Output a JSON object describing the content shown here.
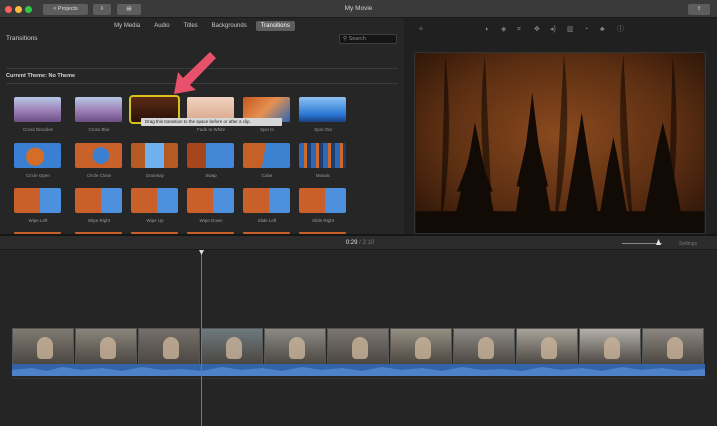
{
  "window": {
    "title": "My Movie",
    "projects_button": "< Projects",
    "colors": {
      "accent_selected": "#d6c21a",
      "arrow": "#e8516b",
      "audio": "#3364a8"
    }
  },
  "browser": {
    "tabs": [
      {
        "label": "My Media",
        "active": false
      },
      {
        "label": "Audio",
        "active": false
      },
      {
        "label": "Titles",
        "active": false
      },
      {
        "label": "Backgrounds",
        "active": false
      },
      {
        "label": "Transitions",
        "active": true
      }
    ],
    "section_title": "Transitions",
    "search_placeholder": "Search",
    "current_theme": "Current Theme: No Theme",
    "tooltip": "Drag this transition to the space before or after a clip.",
    "transitions": [
      {
        "label": "Cross Dissolve",
        "style": "mist"
      },
      {
        "label": "Cross Blur",
        "style": "mist"
      },
      {
        "label": "Fade to Black",
        "style": "dark",
        "selected": true
      },
      {
        "label": "Fade to White",
        "style": "light"
      },
      {
        "label": "Spin In",
        "style": "orange"
      },
      {
        "label": "Spin Out",
        "style": "blue"
      },
      {
        "label": "Circle Open",
        "style": "blue-orange"
      },
      {
        "label": "Circle Close",
        "style": "orange-blue"
      },
      {
        "label": "Doorway",
        "style": "doorway"
      },
      {
        "label": "Swap",
        "style": "swap"
      },
      {
        "label": "Cube",
        "style": "cube"
      },
      {
        "label": "Mosaic",
        "style": "mosaic"
      },
      {
        "label": "Wipe Left",
        "style": "wipe"
      },
      {
        "label": "Wipe Right",
        "style": "wipe"
      },
      {
        "label": "Wipe Up",
        "style": "wipe"
      },
      {
        "label": "Wipe Down",
        "style": "wipe"
      },
      {
        "label": "Slide Left",
        "style": "wipe"
      },
      {
        "label": "Slide Right",
        "style": "wipe"
      }
    ]
  },
  "viewer": {
    "tools": [
      "wand-icon",
      "color-balance-icon",
      "crop-icon",
      "stabilize-icon",
      "volume-icon",
      "noise-eq-icon",
      "speed-icon",
      "filter-icon",
      "info-icon"
    ]
  },
  "timeline": {
    "current_time": "0:29",
    "total_time": "2:10",
    "settings_label": "Settings",
    "clip_count": 11
  }
}
